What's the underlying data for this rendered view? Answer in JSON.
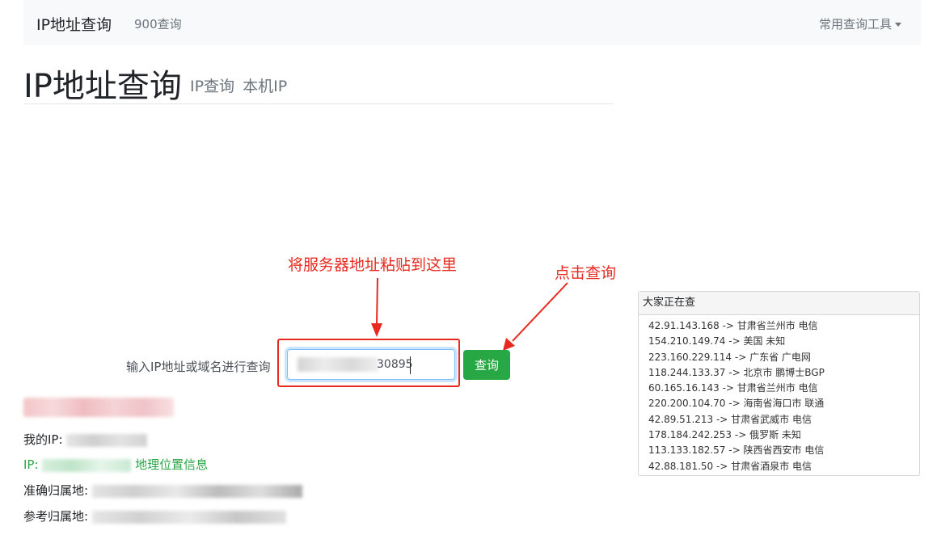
{
  "navbar": {
    "brand": "IP地址查询",
    "link_900": "900查询",
    "tools_dropdown": "常用查询工具"
  },
  "header": {
    "title": "IP地址查询",
    "sub_ip_query": "IP查询",
    "sub_local_ip": "本机IP"
  },
  "annotations": {
    "paste_hint": "将服务器地址粘贴到这里",
    "click_hint": "点击查询",
    "color": "#e8291f"
  },
  "query": {
    "label": "输入IP地址或域名进行查询",
    "input_visible_value": "30895",
    "button_label": "查询",
    "button_color": "#28a745"
  },
  "results": {
    "my_ip_label": "我的IP:",
    "ip_prefix": "IP:",
    "geo_link": "地理位置信息",
    "exact_location_label": "准确归属地:",
    "reference_location_label": "参考归属地:"
  },
  "recent": {
    "title": "大家正在查",
    "items": [
      "42.91.143.168 -> 甘肃省兰州市 电信",
      "154.210.149.74 -> 美国 未知",
      "223.160.229.114 -> 广东省 广电网",
      "118.244.133.37 -> 北京市 鹏博士BGP",
      "60.165.16.143 -> 甘肃省兰州市 电信",
      "220.200.104.70 -> 海南省海口市 联通",
      "42.89.51.213 -> 甘肃省武威市 电信",
      "178.184.242.253 -> 俄罗斯 未知",
      "113.133.182.57 -> 陕西省西安市 电信",
      "42.88.181.50 -> 甘肃省酒泉市 电信"
    ]
  }
}
